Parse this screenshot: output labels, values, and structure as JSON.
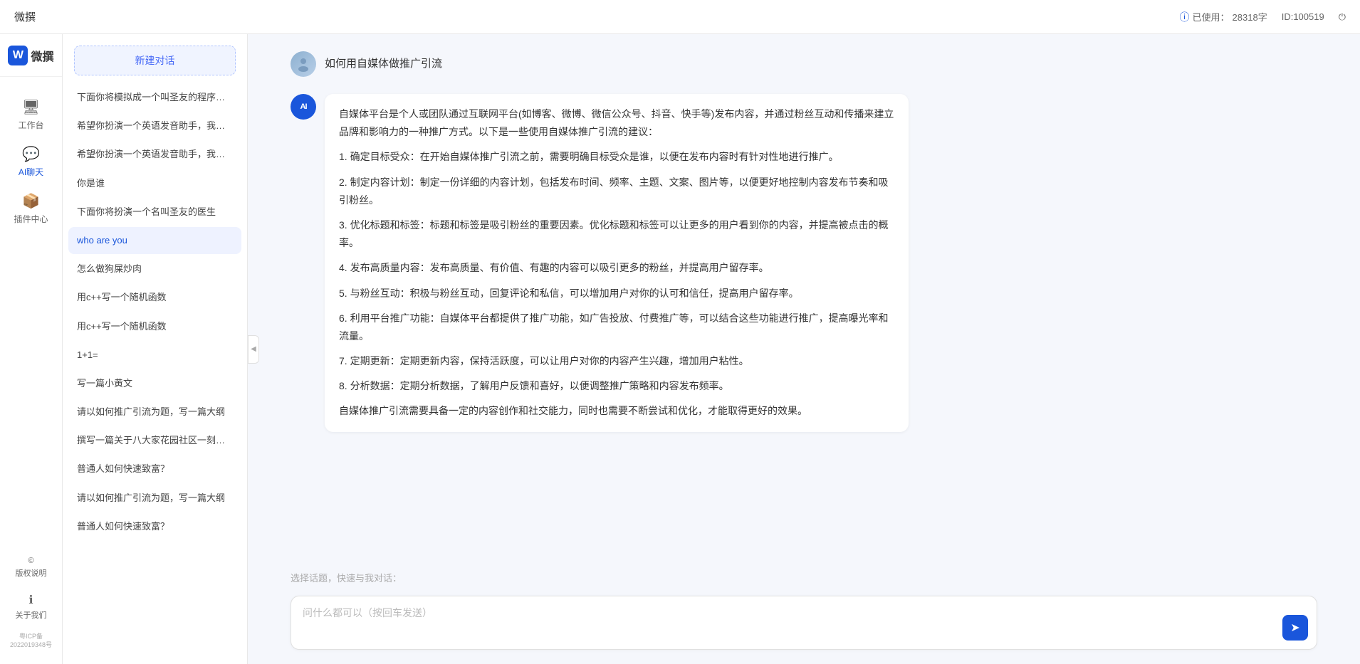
{
  "topbar": {
    "title": "微撰",
    "usage_label": "已使用：",
    "usage_count": "28318字",
    "id_label": "ID:100519",
    "logout_icon": "⏻"
  },
  "left_nav": {
    "logo_letter": "W",
    "logo_name": "微撰",
    "items": [
      {
        "id": "workbench",
        "icon": "🖥",
        "label": "工作台",
        "active": false
      },
      {
        "id": "ai-chat",
        "icon": "💬",
        "label": "AI聊天",
        "active": true
      },
      {
        "id": "plugin",
        "icon": "📦",
        "label": "插件中心",
        "active": false
      }
    ],
    "bottom_items": [
      {
        "id": "copyright",
        "icon": "©",
        "label": "版权说明"
      },
      {
        "id": "about",
        "icon": "ℹ",
        "label": "关于我们"
      }
    ],
    "icp": "粤ICP备2022019348号"
  },
  "chat_sidebar": {
    "new_chat_label": "新建对话",
    "history": [
      {
        "id": 1,
        "text": "下面你将模拟成一个叫圣友的程序员，我说...",
        "active": false
      },
      {
        "id": 2,
        "text": "希望你扮演一个英语发音助手，我提供给你...",
        "active": false
      },
      {
        "id": 3,
        "text": "希望你扮演一个英语发音助手，我提供给你...",
        "active": false
      },
      {
        "id": 4,
        "text": "你是谁",
        "active": false
      },
      {
        "id": 5,
        "text": "下面你将扮演一个名叫圣友的医生",
        "active": false
      },
      {
        "id": 6,
        "text": "who are you",
        "active": true
      },
      {
        "id": 7,
        "text": "怎么做狗屎炒肉",
        "active": false
      },
      {
        "id": 8,
        "text": "用c++写一个随机函数",
        "active": false
      },
      {
        "id": 9,
        "text": "用c++写一个随机函数",
        "active": false
      },
      {
        "id": 10,
        "text": "1+1=",
        "active": false
      },
      {
        "id": 11,
        "text": "写一篇小黄文",
        "active": false
      },
      {
        "id": 12,
        "text": "请以如何推广引流为题，写一篇大纲",
        "active": false
      },
      {
        "id": 13,
        "text": "撰写一篇关于八大家花园社区一刻钟便民生...",
        "active": false
      },
      {
        "id": 14,
        "text": "普通人如何快速致富？",
        "active": false
      },
      {
        "id": 15,
        "text": "请以如何推广引流为题，写一篇大纲",
        "active": false
      },
      {
        "id": 16,
        "text": "普通人如何快速致富？",
        "active": false
      }
    ]
  },
  "chat": {
    "user_message": "如何用自媒体做推广引流",
    "ai_response_paragraphs": [
      "自媒体平台是个人或团队通过互联网平台(如博客、微博、微信公众号、抖音、快手等)发布内容，并通过粉丝互动和传播来建立品牌和影响力的一种推广方式。以下是一些使用自媒体推广引流的建议：",
      "1. 确定目标受众：在开始自媒体推广引流之前，需要明确目标受众是谁，以便在发布内容时有针对性地进行推广。",
      "2. 制定内容计划：制定一份详细的内容计划，包括发布时间、频率、主题、文案、图片等，以便更好地控制内容发布节奏和吸引粉丝。",
      "3. 优化标题和标签：标题和标签是吸引粉丝的重要因素。优化标题和标签可以让更多的用户看到你的内容，并提高被点击的概率。",
      "4. 发布高质量内容：发布高质量、有价值、有趣的内容可以吸引更多的粉丝，并提高用户留存率。",
      "5. 与粉丝互动：积极与粉丝互动，回复评论和私信，可以增加用户对你的认可和信任，提高用户留存率。",
      "6. 利用平台推广功能：自媒体平台都提供了推广功能，如广告投放、付费推广等，可以结合这些功能进行推广，提高曝光率和流量。",
      "7. 定期更新：定期更新内容，保持活跃度，可以让用户对你的内容产生兴趣，增加用户粘性。",
      "8. 分析数据：定期分析数据，了解用户反馈和喜好，以便调整推广策略和内容发布频率。",
      "自媒体推广引流需要具备一定的内容创作和社交能力，同时也需要不断尝试和优化，才能取得更好的效果。"
    ],
    "quick_select_placeholder": "选择话题，快速与我对话：",
    "input_placeholder": "问什么都可以（按回车发送）"
  }
}
